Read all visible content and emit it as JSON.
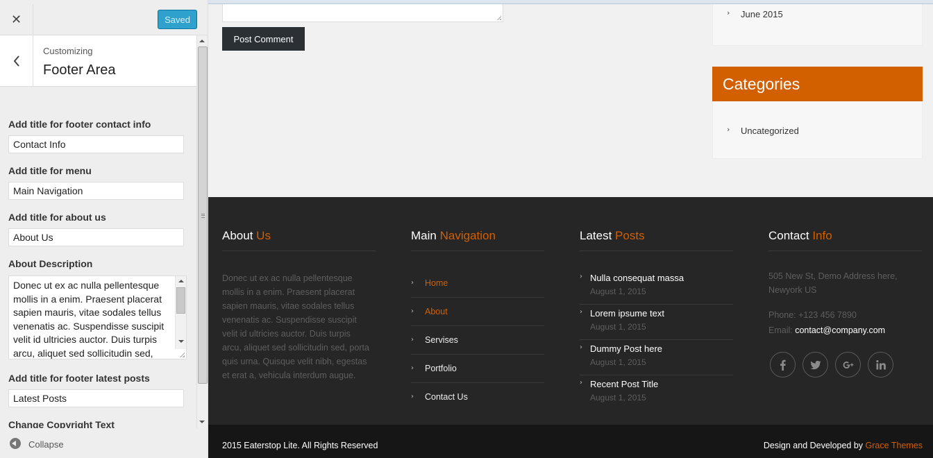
{
  "customizer": {
    "close_symbol": "✕",
    "saved_label": "Saved",
    "customizing_label": "Customizing",
    "section_title": "Footer Area",
    "fields": {
      "contact_title_label": "Add title for footer contact info",
      "contact_title_value": "Contact Info",
      "menu_title_label": "Add title for menu",
      "menu_title_value": "Main Navigation",
      "about_title_label": "Add title for about us",
      "about_title_value": "About Us",
      "about_desc_label": "About Description",
      "about_desc_value": "Donec ut ex ac nulla pellentesque mollis in a enim. Praesent placerat sapien mauris, vitae sodales tellus venenatis ac. Suspendisse suscipit velit id ultricies auctor. Duis turpis arcu, aliquet sed sollicitudin sed,",
      "latest_title_label": "Add title for footer latest posts",
      "latest_title_value": "Latest Posts",
      "copyright_label": "Change Copyright Text"
    },
    "collapse_label": "Collapse"
  },
  "preview": {
    "post_comment_label": "Post Comment",
    "archives": {
      "items": [
        "June 2015"
      ]
    },
    "categories": {
      "title": "Categories",
      "items": [
        "Uncategorized"
      ]
    },
    "footer": {
      "about": {
        "title_main": "About",
        "title_accent": "Us",
        "text": "Donec ut ex ac nulla pellentesque mollis in a enim. Praesent placerat sapien mauris, vitae sodales tellus venenatis ac. Suspendisse suscipit velit id ultricies auctor. Duis turpis arcu, aliquet sed sollicitudin sed, porta quis urna. Quisque velit nibh, egestas et erat a, vehicula interdum augue."
      },
      "nav": {
        "title_main": "Main",
        "title_accent": "Navigation",
        "items": [
          "Home",
          "About",
          "Servises",
          "Portfolio",
          "Contact Us"
        ]
      },
      "posts": {
        "title_main": "Latest",
        "title_accent": "Posts",
        "items": [
          {
            "title": "Nulla consequat massa",
            "date": "August 1, 2015"
          },
          {
            "title": "Lorem ipsume text",
            "date": "August 1, 2015"
          },
          {
            "title": "Dummy Post here",
            "date": "August 1, 2015"
          },
          {
            "title": "Recent Post Title",
            "date": "August 1, 2015"
          }
        ]
      },
      "contact": {
        "title_main": "Contact",
        "title_accent": "Info",
        "address": "505 New St, Demo Address here, Newyork US",
        "phone": "Phone: +123 456 7890",
        "email_label": "Email:",
        "email": "contact@company.com",
        "social_icons": [
          "facebook-icon",
          "twitter-icon",
          "google-plus-icon",
          "linkedin-icon"
        ]
      }
    },
    "bottom": {
      "copyright": "2015 Eaterstop Lite. All Rights Reserved",
      "credit_prefix": "Design and Developed by",
      "credit_link": "Grace Themes"
    }
  },
  "colors": {
    "accent": "#d25f00",
    "saved_button": "#2ea2cc",
    "footer_bg": "#262626",
    "bottom_bar_bg": "#161616"
  }
}
